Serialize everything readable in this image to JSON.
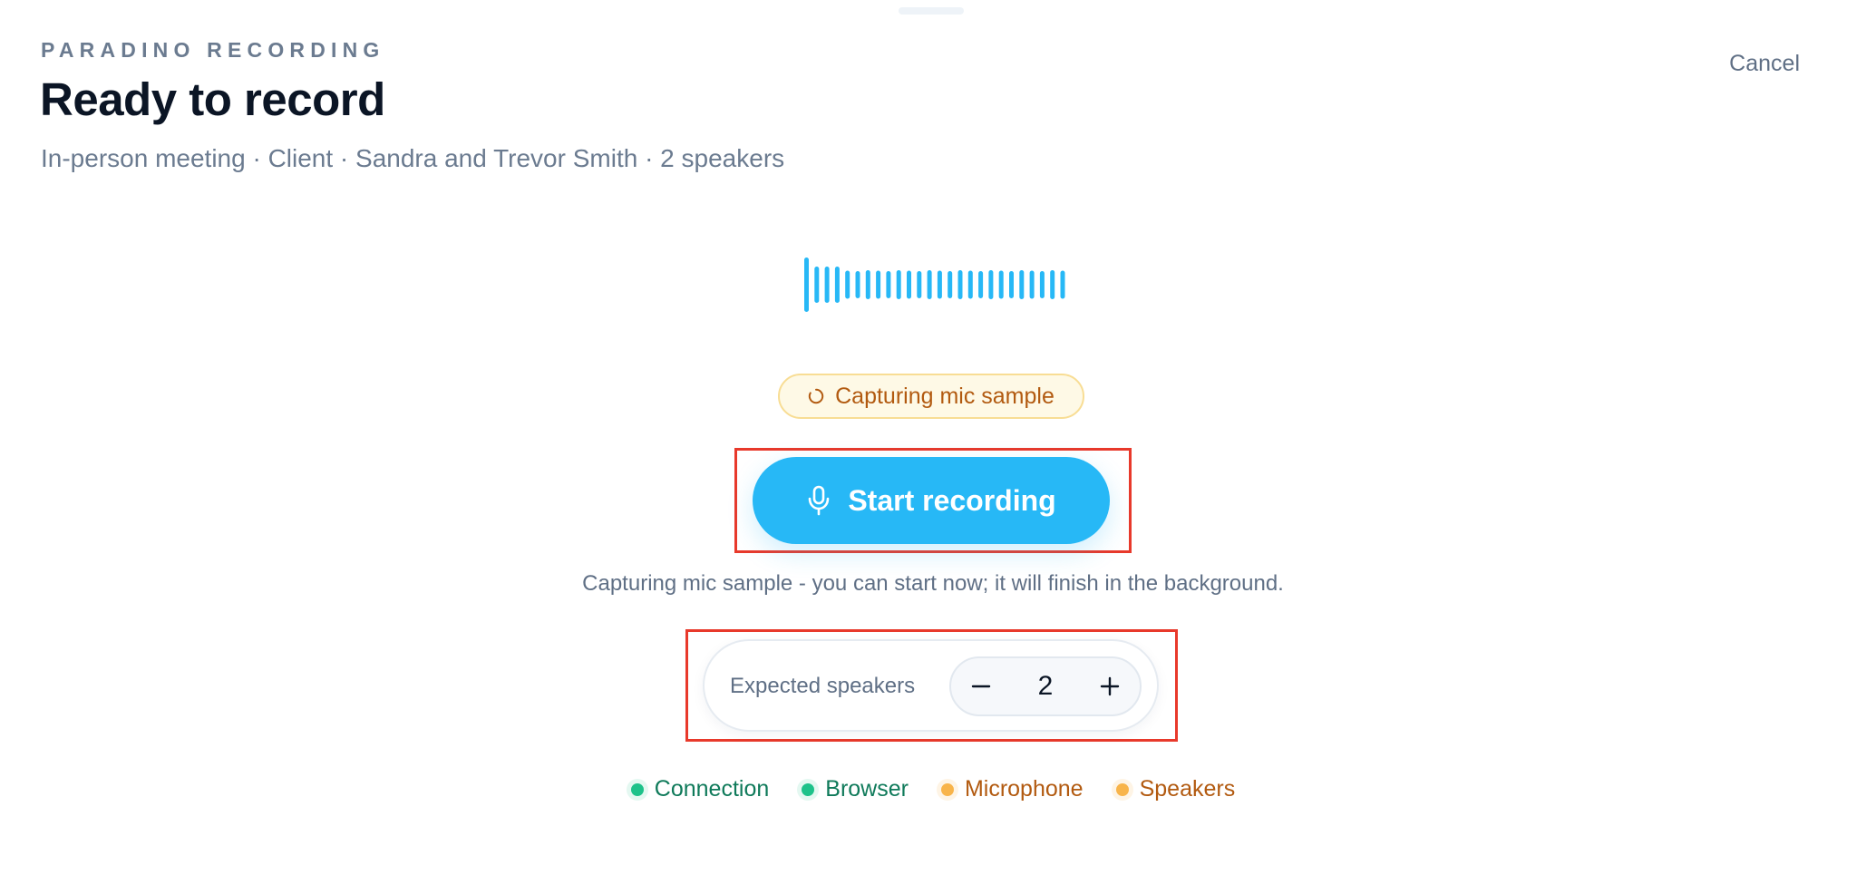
{
  "header": {
    "eyebrow": "PARADINO RECORDING",
    "title": "Ready to record",
    "subtitle": "In-person meeting · Client · Sandra and Trevor Smith · 2 speakers",
    "cancel_label": "Cancel"
  },
  "status": {
    "label": "Capturing mic sample",
    "icon": "spinner-icon"
  },
  "start_button": {
    "label": "Start recording",
    "icon": "microphone-icon"
  },
  "helper_text": "Capturing mic sample - you can start now; it will finish in the background.",
  "speakers": {
    "label": "Expected speakers",
    "value": "2",
    "decrement_icon": "minus-icon",
    "increment_icon": "plus-icon"
  },
  "checks": [
    {
      "label": "Connection",
      "state": "ok"
    },
    {
      "label": "Browser",
      "state": "ok"
    },
    {
      "label": "Microphone",
      "state": "warn"
    },
    {
      "label": "Speakers",
      "state": "warn"
    }
  ],
  "colors": {
    "accent": "#27b8f6",
    "ok": "#1ec28a",
    "warn": "#f8b44a",
    "highlight": "#e8392b"
  }
}
